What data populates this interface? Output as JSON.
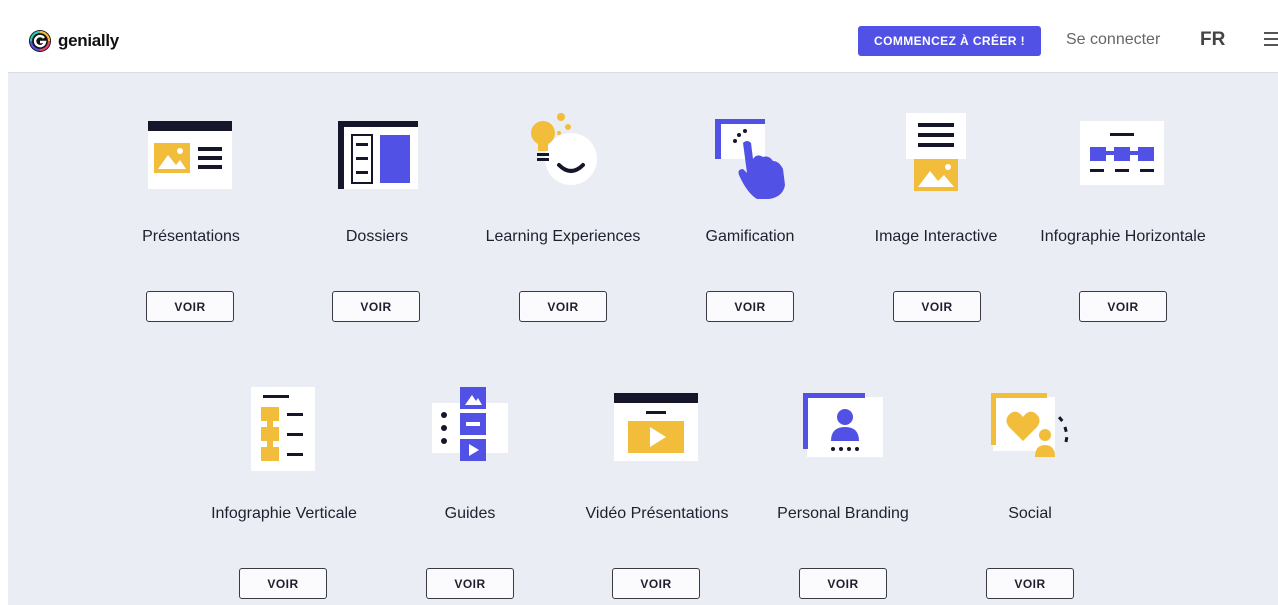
{
  "brand": {
    "name": "genially"
  },
  "nav": {
    "cta_label": "COMMENCEZ À CRÉER !",
    "login_label": "Se connecter",
    "language": "FR"
  },
  "templates": [
    {
      "title": "Présentations",
      "button": "VOIR",
      "icon": "presentation-icon"
    },
    {
      "title": "Dossiers",
      "button": "VOIR",
      "icon": "dossier-icon"
    },
    {
      "title": "Learning Experiences",
      "button": "VOIR",
      "icon": "lightbulb-icon"
    },
    {
      "title": "Gamification",
      "button": "VOIR",
      "icon": "hand-pointer-icon"
    },
    {
      "title": "Image Interactive",
      "button": "VOIR",
      "icon": "interactive-image-icon"
    },
    {
      "title": "Infographie Horizontale",
      "button": "VOIR",
      "icon": "horizontal-infographic-icon"
    },
    {
      "title": "Infographie Verticale",
      "button": "VOIR",
      "icon": "vertical-infographic-icon"
    },
    {
      "title": "Guides",
      "button": "VOIR",
      "icon": "guide-icon"
    },
    {
      "title": "Vidéo Présentations",
      "button": "VOIR",
      "icon": "video-play-icon"
    },
    {
      "title": "Personal Branding",
      "button": "VOIR",
      "icon": "personal-branding-icon"
    },
    {
      "title": "Social",
      "button": "VOIR",
      "icon": "social-heart-icon"
    }
  ],
  "colors": {
    "accent": "#5151e6",
    "yellow": "#f2bd3a",
    "dark": "#16162a",
    "background": "#ebedf5"
  }
}
